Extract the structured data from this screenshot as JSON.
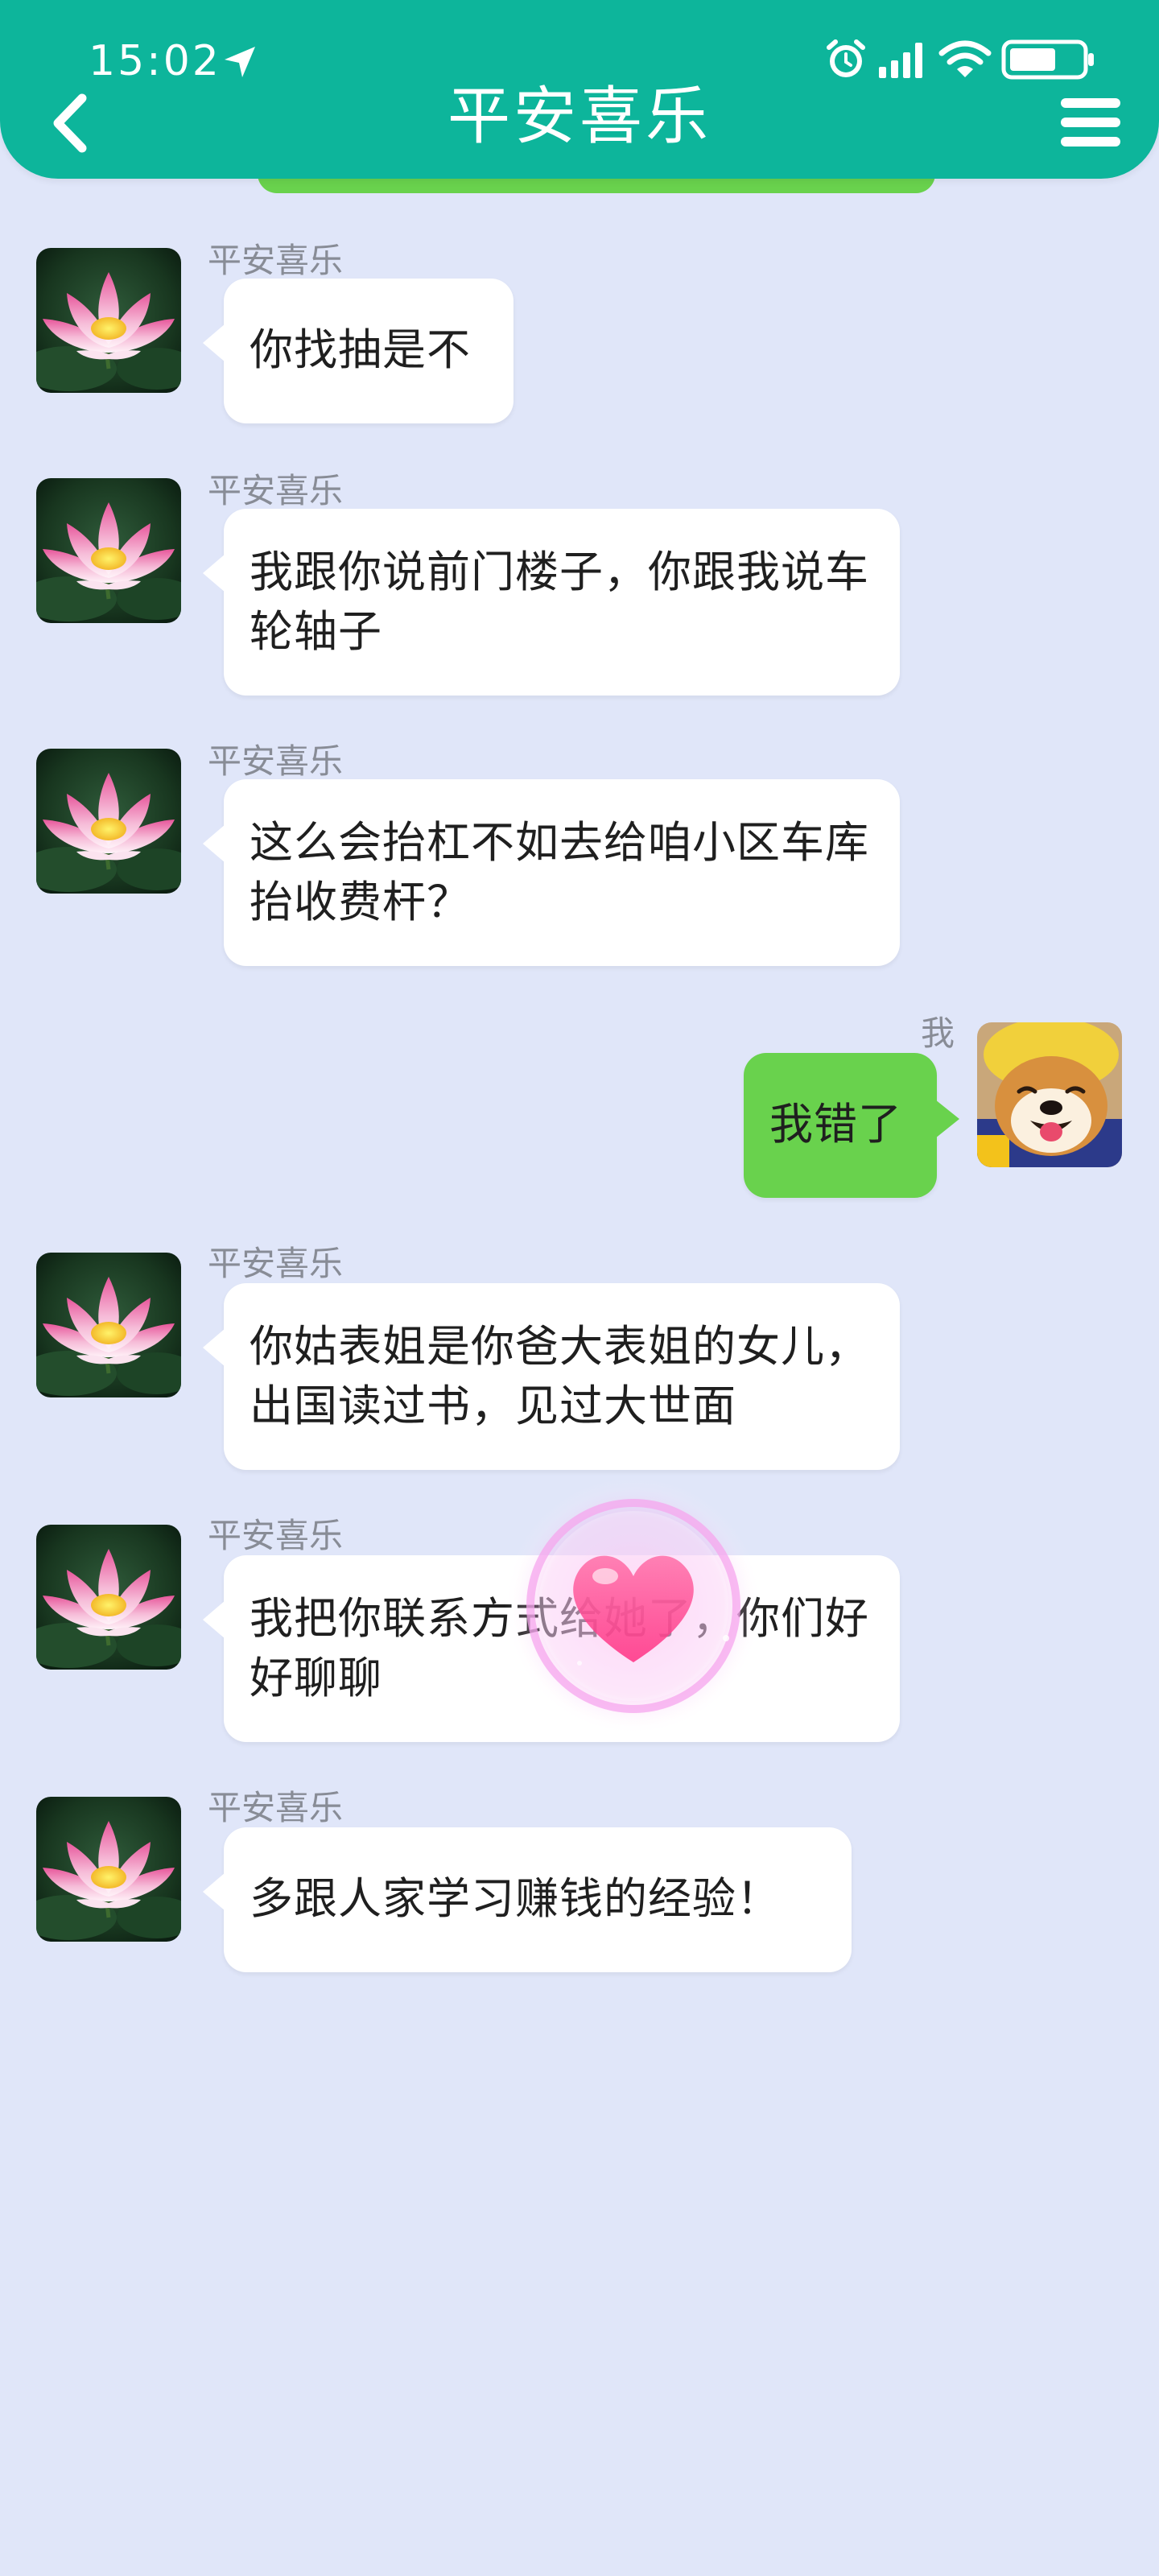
{
  "status_bar": {
    "time": "15:02",
    "icons": [
      "location-arrow-icon",
      "alarm-icon",
      "signal-icon",
      "wifi-icon",
      "battery-icon"
    ]
  },
  "header": {
    "title": "平安喜乐",
    "back_icon": "chevron-left-icon",
    "menu_icon": "menu-icon"
  },
  "colors": {
    "header_bg": "#0db59b",
    "chat_bg": "#e0e6f9",
    "incoming_bubble": "#ffffff",
    "outgoing_bubble": "#69d24d"
  },
  "messages": [
    {
      "side": "left",
      "sender": "平安喜乐",
      "text": "你找抽是不",
      "avatar": "lotus-flower-avatar"
    },
    {
      "side": "left",
      "sender": "平安喜乐",
      "text": "我跟你说前门楼子，你跟我说车轮轴子",
      "avatar": "lotus-flower-avatar"
    },
    {
      "side": "left",
      "sender": "平安喜乐",
      "text": "这么会抬杠不如去给咱小区车库抬收费杆？",
      "avatar": "lotus-flower-avatar"
    },
    {
      "side": "right",
      "sender": "我",
      "text": "我错了",
      "avatar": "shiba-dog-avatar"
    },
    {
      "side": "left",
      "sender": "平安喜乐",
      "text": "你姑表姐是你爸大表姐的女儿，出国读过书，见过大世面",
      "avatar": "lotus-flower-avatar"
    },
    {
      "side": "left",
      "sender": "平安喜乐",
      "text": "我把你联系方式给她了，你们好好聊聊",
      "avatar": "lotus-flower-avatar"
    },
    {
      "side": "left",
      "sender": "平安喜乐",
      "text": "多跟人家学习赚钱的经验！",
      "avatar": "lotus-flower-avatar"
    }
  ],
  "overlay": {
    "icon": "heart-icon"
  }
}
